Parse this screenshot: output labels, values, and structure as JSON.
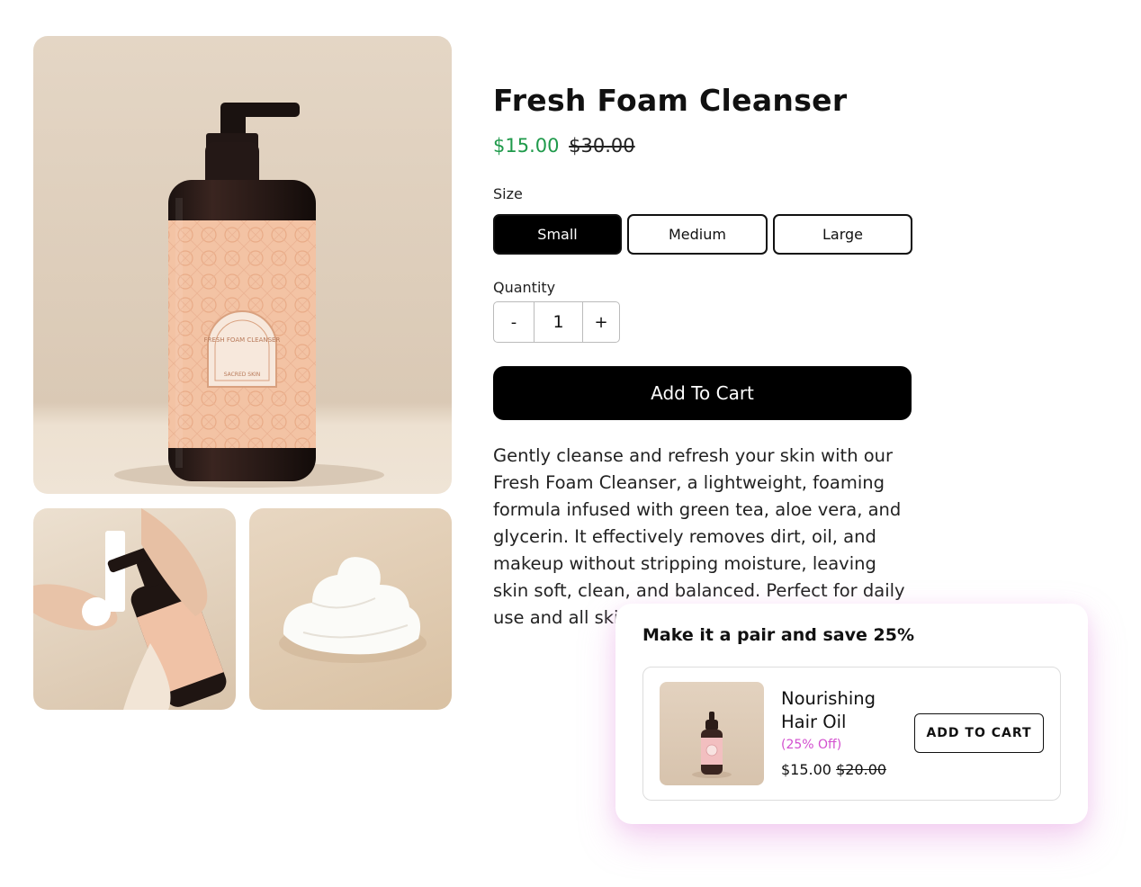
{
  "product": {
    "title": "Fresh Foam Cleanser",
    "price_sale": "$15.00",
    "price_original": "$30.00",
    "description": "Gently cleanse and refresh your skin with our Fresh Foam Cleanser, a lightweight, foaming formula infused with green tea, aloe vera, and glycerin. It effectively removes dirt, oil, and makeup without stripping moisture, leaving skin soft, clean, and balanced. Perfect for daily use and all ski",
    "bottle_label": {
      "name": "FRESH FOAM CLEANSER",
      "brand": "SACRED SKIN"
    }
  },
  "size": {
    "label": "Size",
    "options": [
      "Small",
      "Medium",
      "Large"
    ],
    "selected": "Small"
  },
  "quantity": {
    "label": "Quantity",
    "minus": "-",
    "value": "1",
    "plus": "+"
  },
  "add_to_cart_label": "Add To Cart",
  "upsell": {
    "title": "Make it a pair and save 25%",
    "product_name": "Nourishing Hair Oil",
    "discount": "(25% Off)",
    "price_sale": "$15.00",
    "price_original": "$20.00",
    "button_label": "ADD TO CART"
  },
  "colors": {
    "sale_price": "#1f9a4b",
    "discount_text": "#d34fcf",
    "button_bg": "#000000",
    "label_peach": "#f2bfa0"
  }
}
